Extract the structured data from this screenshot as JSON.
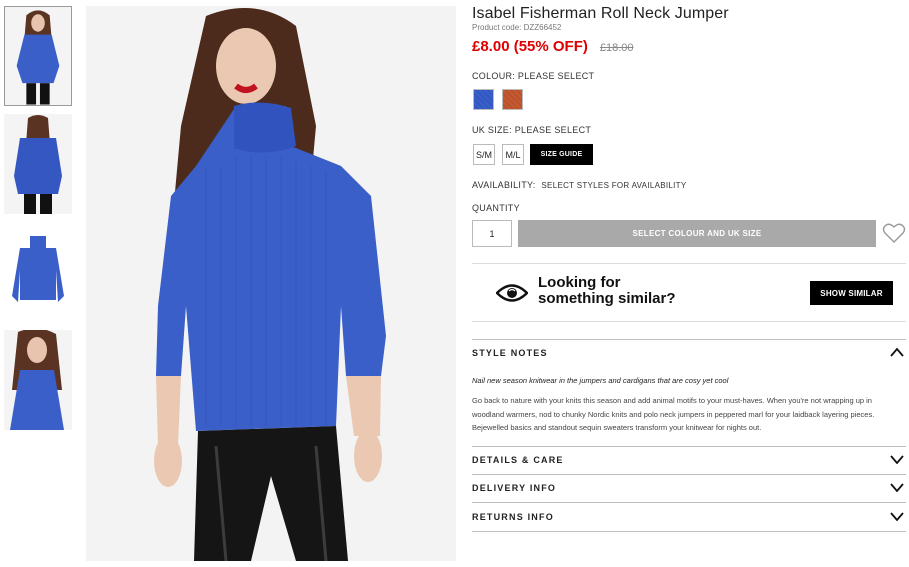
{
  "product": {
    "title": "Isabel Fisherman Roll Neck Jumper",
    "product_code": "Product code: DZZ66452",
    "price_now": "£8.00 (55% OFF)",
    "price_was": "£18.00"
  },
  "colour": {
    "label": "COLOUR:",
    "value": "PLEASE SELECT",
    "options": [
      "blue",
      "rust"
    ],
    "colors": {
      "blue": "#3a5fc9",
      "rust": "#c55a32"
    }
  },
  "size": {
    "label": "UK SIZE:",
    "value": "PLEASE SELECT",
    "options": [
      "S/M",
      "M/L"
    ],
    "guide_label": "SIZE GUIDE"
  },
  "availability": {
    "label": "AVAILABILITY:",
    "value": "SELECT STYLES FOR AVAILABILITY"
  },
  "quantity": {
    "label": "QUANTITY",
    "value": "1"
  },
  "add_button": "SELECT COLOUR AND UK SIZE",
  "similar": {
    "line1": "Looking for",
    "line2": "something similar?",
    "button": "SHOW SIMILAR"
  },
  "style_notes": {
    "heading": "STYLE NOTES",
    "intro": "Nail new season knitwear in the jumpers and cardigans that are cosy yet cool",
    "body": "Go back to nature with your knits this season and add animal motifs to your must-haves. When you're not wrapping up in woodland warmers, nod to chunky Nordic knits and polo neck jumpers in peppered marl for your laidback layering pieces. Bejewelled basics and standout sequin sweaters transform your knitwear for nights out."
  },
  "accordions": [
    "DETAILS & CARE",
    "DELIVERY INFO",
    "RETURNS INFO"
  ],
  "icons": [
    "eye-icon",
    "heart-icon",
    "chevron-up-icon",
    "chevron-down-icon"
  ]
}
